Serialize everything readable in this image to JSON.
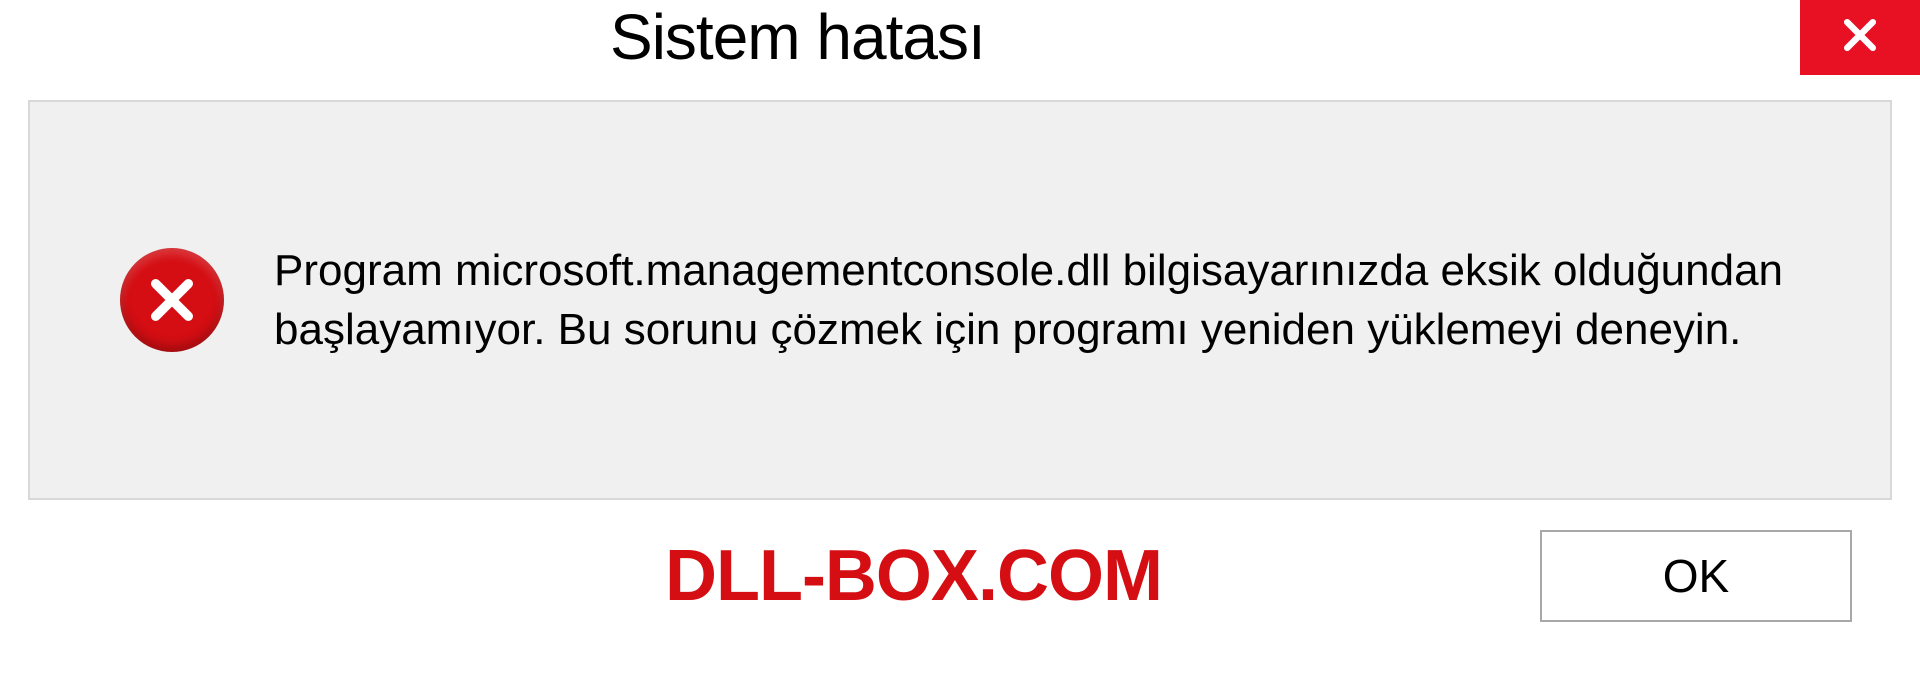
{
  "dialog": {
    "title": "Sistem hatası",
    "message": "Program microsoft.managementconsole.dll bilgisayarınızda eksik olduğundan başlayamıyor. Bu sorunu çözmek için programı yeniden yüklemeyi deneyin.",
    "ok_label": "OK"
  },
  "watermark": "DLL-BOX.COM"
}
